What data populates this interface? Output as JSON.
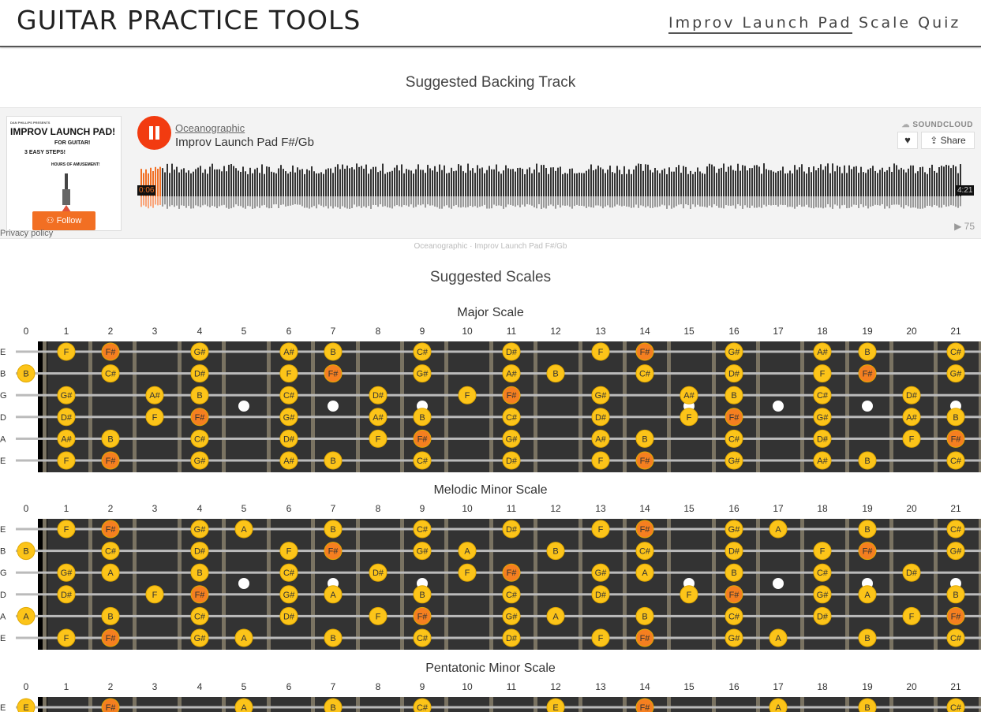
{
  "header": {
    "site_title": "GUITAR PRACTICE TOOLS",
    "nav": [
      "Improv Launch Pad",
      "Scale Quiz"
    ]
  },
  "backing_track": {
    "heading": "Suggested Backing Track",
    "artist": "Oceanographic",
    "track_title": "Improv Launch Pad F#/Gb",
    "art_lines": [
      "IMPROV LAUNCH PAD!",
      "FOR GUITAR!",
      "3 EASY STEPS!",
      "HOURS OF AMUSEMENT!"
    ],
    "art_small": "DAN PHILLIPS PRESENTS",
    "follow_label": "Follow",
    "privacy": "Privacy policy",
    "brand": "SOUNDCLOUD",
    "share_label": "Share",
    "time_elapsed": "0:06",
    "time_total": "4:21",
    "plays": "75",
    "caption": "Oceanographic · Improv Launch Pad F#/Gb",
    "colors": {
      "play": "#f23b10",
      "accent": "#f26f23"
    }
  },
  "scales_heading": "Suggested Scales",
  "fret_numbers": [
    "0",
    "1",
    "2",
    "3",
    "4",
    "5",
    "6",
    "7",
    "8",
    "9",
    "10",
    "11",
    "12",
    "13",
    "14",
    "15",
    "16",
    "17",
    "18",
    "19",
    "20",
    "21"
  ],
  "string_names": [
    "E",
    "B",
    "G",
    "D",
    "A",
    "E"
  ],
  "colors": {
    "note": "#fcc419",
    "root": "#f57f20",
    "board": "#333333",
    "fret": "#7a7362"
  },
  "scales": [
    {
      "name": "Major Scale",
      "root": "F#",
      "strings": [
        [
          "",
          "F",
          "F#",
          "",
          "G#",
          "",
          "A#",
          "B",
          "",
          "C#",
          "",
          "D#",
          "",
          "F",
          "F#",
          "",
          "G#",
          "",
          "A#",
          "B",
          "",
          "C#"
        ],
        [
          "B",
          "",
          "C#",
          "",
          "D#",
          "",
          "F",
          "F#",
          "",
          "G#",
          "",
          "A#",
          "B",
          "",
          "C#",
          "",
          "D#",
          "",
          "F",
          "F#",
          "",
          "G#"
        ],
        [
          "",
          "G#",
          "",
          "A#",
          "B",
          "",
          "C#",
          "",
          "D#",
          "",
          "F",
          "F#",
          "",
          "G#",
          "",
          "A#",
          "B",
          "",
          "C#",
          "",
          "D#",
          ""
        ],
        [
          "",
          "D#",
          "",
          "F",
          "F#",
          "",
          "G#",
          "",
          "A#",
          "B",
          "",
          "C#",
          "",
          "D#",
          "",
          "F",
          "F#",
          "",
          "G#",
          "",
          "A#",
          "B"
        ],
        [
          "",
          "A#",
          "B",
          "",
          "C#",
          "",
          "D#",
          "",
          "F",
          "F#",
          "",
          "G#",
          "",
          "A#",
          "B",
          "",
          "C#",
          "",
          "D#",
          "",
          "F",
          "F#"
        ],
        [
          "",
          "F",
          "F#",
          "",
          "G#",
          "",
          "A#",
          "B",
          "",
          "C#",
          "",
          "D#",
          "",
          "F",
          "F#",
          "",
          "G#",
          "",
          "A#",
          "B",
          "",
          "C#"
        ]
      ]
    },
    {
      "name": "Melodic Minor Scale",
      "root": "F#",
      "strings": [
        [
          "",
          "F",
          "F#",
          "",
          "G#",
          "A",
          "",
          "B",
          "",
          "C#",
          "",
          "D#",
          "",
          "F",
          "F#",
          "",
          "G#",
          "A",
          "",
          "B",
          "",
          "C#"
        ],
        [
          "B",
          "",
          "C#",
          "",
          "D#",
          "",
          "F",
          "F#",
          "",
          "G#",
          "A",
          "",
          "B",
          "",
          "C#",
          "",
          "D#",
          "",
          "F",
          "F#",
          "",
          "G#"
        ],
        [
          "",
          "G#",
          "A",
          "",
          "B",
          "",
          "C#",
          "",
          "D#",
          "",
          "F",
          "F#",
          "",
          "G#",
          "A",
          "",
          "B",
          "",
          "C#",
          "",
          "D#",
          ""
        ],
        [
          "",
          "D#",
          "",
          "F",
          "F#",
          "",
          "G#",
          "A",
          "",
          "B",
          "",
          "C#",
          "",
          "D#",
          "",
          "F",
          "F#",
          "",
          "G#",
          "A",
          "",
          "B"
        ],
        [
          "A",
          "",
          "B",
          "",
          "C#",
          "",
          "D#",
          "",
          "F",
          "F#",
          "",
          "G#",
          "A",
          "",
          "B",
          "",
          "C#",
          "",
          "D#",
          "",
          "F",
          "F#"
        ],
        [
          "",
          "F",
          "F#",
          "",
          "G#",
          "A",
          "",
          "B",
          "",
          "C#",
          "",
          "D#",
          "",
          "F",
          "F#",
          "",
          "G#",
          "A",
          "",
          "B",
          "",
          "C#"
        ]
      ]
    },
    {
      "name": "Pentatonic Minor Scale",
      "root": "F#",
      "strings": [
        [
          "E",
          "",
          "F#",
          "",
          "",
          "A",
          "",
          "B",
          "",
          "C#",
          "",
          "",
          "E",
          "",
          "F#",
          "",
          "",
          "A",
          "",
          "B",
          "",
          "C#"
        ]
      ]
    }
  ]
}
